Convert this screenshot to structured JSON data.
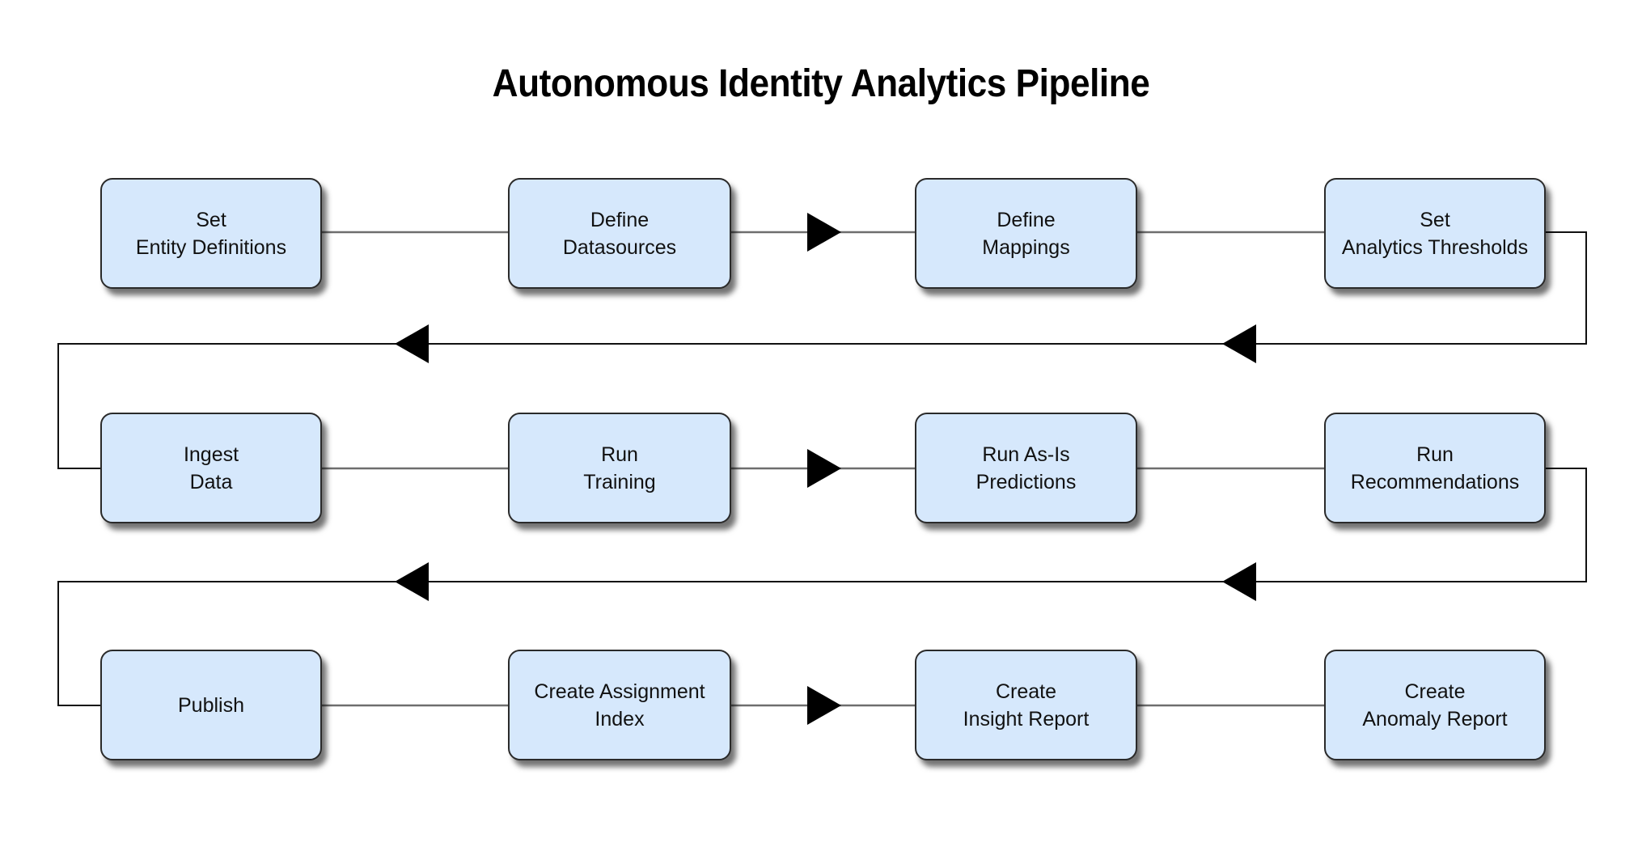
{
  "title": "Autonomous Identity Analytics Pipeline",
  "colors": {
    "node_fill": "#d6e8fc",
    "node_border": "#2a2a2a",
    "connector": "#6e6e6e",
    "return_line": "#111111",
    "arrowhead": "#000000"
  },
  "rows": [
    {
      "direction": "left-to-right",
      "steps": [
        {
          "id": "set-entity-definitions",
          "lines": [
            "Set",
            "Entity Definitions"
          ]
        },
        {
          "id": "define-datasources",
          "lines": [
            "Define",
            "Datasources"
          ]
        },
        {
          "id": "define-mappings",
          "lines": [
            "Define",
            "Mappings"
          ]
        },
        {
          "id": "set-analytics-thresholds",
          "lines": [
            "Set",
            "Analytics Thresholds"
          ]
        }
      ]
    },
    {
      "direction": "left-to-right",
      "steps": [
        {
          "id": "ingest-data",
          "lines": [
            "Ingest",
            "Data"
          ]
        },
        {
          "id": "run-training",
          "lines": [
            "Run",
            "Training"
          ]
        },
        {
          "id": "run-as-is-predictions",
          "lines": [
            "Run As-Is",
            "Predictions"
          ]
        },
        {
          "id": "run-recommendations",
          "lines": [
            "Run",
            "Recommendations"
          ]
        }
      ]
    },
    {
      "direction": "left-to-right",
      "steps": [
        {
          "id": "publish",
          "lines": [
            "Publish"
          ]
        },
        {
          "id": "create-assignment-index",
          "lines": [
            "Create Assignment",
            "Index"
          ]
        },
        {
          "id": "create-insight-report",
          "lines": [
            "Create",
            "Insight Report"
          ]
        },
        {
          "id": "create-anomaly-report",
          "lines": [
            "Create",
            "Anomaly Report"
          ]
        }
      ]
    }
  ],
  "flow": [
    {
      "from": "set-entity-definitions",
      "to": "define-datasources"
    },
    {
      "from": "define-datasources",
      "to": "define-mappings",
      "arrow": "right"
    },
    {
      "from": "define-mappings",
      "to": "set-analytics-thresholds"
    },
    {
      "from": "set-analytics-thresholds",
      "to": "ingest-data",
      "arrow": "left",
      "wrap": true
    },
    {
      "from": "ingest-data",
      "to": "run-training"
    },
    {
      "from": "run-training",
      "to": "run-as-is-predictions",
      "arrow": "right"
    },
    {
      "from": "run-as-is-predictions",
      "to": "run-recommendations"
    },
    {
      "from": "run-recommendations",
      "to": "publish",
      "arrow": "left",
      "wrap": true
    },
    {
      "from": "publish",
      "to": "create-assignment-index"
    },
    {
      "from": "create-assignment-index",
      "to": "create-insight-report",
      "arrow": "right"
    },
    {
      "from": "create-insight-report",
      "to": "create-anomaly-report"
    }
  ]
}
